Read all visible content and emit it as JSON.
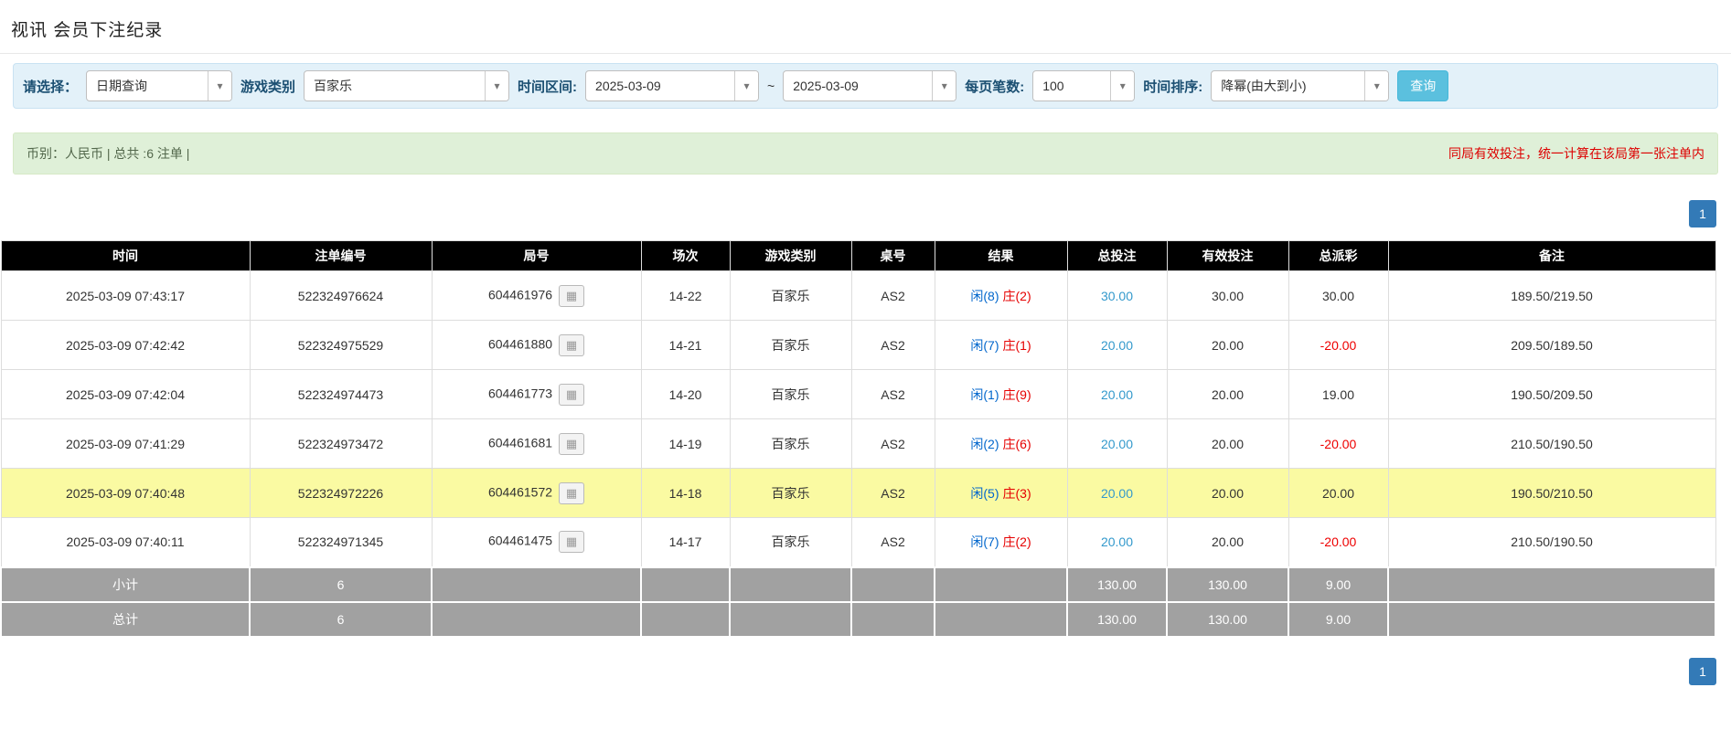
{
  "page": {
    "title": "视讯 会员下注纪录"
  },
  "filters": {
    "select_label": "请选择：",
    "select_value": "日期查询",
    "game_type_label": "游戏类别",
    "game_type_value": "百家乐",
    "date_range_label": "时间区间:",
    "date_from": "2025-03-09",
    "date_separator": "~",
    "date_to": "2025-03-09",
    "page_size_label": "每页笔数:",
    "page_size_value": "100",
    "sort_label": "时间排序:",
    "sort_value": "降幂(由大到小)",
    "search_button": "查询"
  },
  "summary": {
    "left": "币别：人民币 | 总共 :6 注单 |",
    "right": "同局有效投注，统一计算在该局第一张注单内"
  },
  "pagination": {
    "page": "1"
  },
  "icons": {
    "dropdown_caret": "▾",
    "road_icon": "▦"
  },
  "colors": {
    "accent_link_blue": "#3399cc",
    "player_blue": "#0066cc",
    "banker_red": "#e60000",
    "negative_red": "#ee0000",
    "highlight_yellow": "#fafaa2",
    "header_black": "#000000",
    "footer_gray": "#a1a1a1",
    "search_button_blue": "#5bc0de",
    "pagination_blue": "#337ab7",
    "filter_bar_blue": "#e3f1f9",
    "summary_bar_green": "#dff0d8",
    "note_red": "#dd0000"
  },
  "table": {
    "headers": [
      "时间",
      "注单编号",
      "局号",
      "场次",
      "游戏类别",
      "桌号",
      "结果",
      "总投注",
      "有效投注",
      "总派彩",
      "备注"
    ],
    "rows": [
      {
        "time": "2025-03-09 07:43:17",
        "bet_id": "522324976624",
        "round_no": "604461976",
        "session": "14-22",
        "game": "百家乐",
        "table_no": "AS2",
        "result_player": "闲(8)",
        "result_banker": "庄(2)",
        "total_bet": "30.00",
        "valid_bet": "30.00",
        "payout": "30.00",
        "note": "189.50/219.50",
        "highlighted": false
      },
      {
        "time": "2025-03-09 07:42:42",
        "bet_id": "522324975529",
        "round_no": "604461880",
        "session": "14-21",
        "game": "百家乐",
        "table_no": "AS2",
        "result_player": "闲(7)",
        "result_banker": "庄(1)",
        "total_bet": "20.00",
        "valid_bet": "20.00",
        "payout": "-20.00",
        "note": "209.50/189.50",
        "highlighted": false
      },
      {
        "time": "2025-03-09 07:42:04",
        "bet_id": "522324974473",
        "round_no": "604461773",
        "session": "14-20",
        "game": "百家乐",
        "table_no": "AS2",
        "result_player": "闲(1)",
        "result_banker": "庄(9)",
        "total_bet": "20.00",
        "valid_bet": "20.00",
        "payout": "19.00",
        "note": "190.50/209.50",
        "highlighted": false
      },
      {
        "time": "2025-03-09 07:41:29",
        "bet_id": "522324973472",
        "round_no": "604461681",
        "session": "14-19",
        "game": "百家乐",
        "table_no": "AS2",
        "result_player": "闲(2)",
        "result_banker": "庄(6)",
        "total_bet": "20.00",
        "valid_bet": "20.00",
        "payout": "-20.00",
        "note": "210.50/190.50",
        "highlighted": false
      },
      {
        "time": "2025-03-09 07:40:48",
        "bet_id": "522324972226",
        "round_no": "604461572",
        "session": "14-18",
        "game": "百家乐",
        "table_no": "AS2",
        "result_player": "闲(5)",
        "result_banker": "庄(3)",
        "total_bet": "20.00",
        "valid_bet": "20.00",
        "payout": "20.00",
        "note": "190.50/210.50",
        "highlighted": true
      },
      {
        "time": "2025-03-09 07:40:11",
        "bet_id": "522324971345",
        "round_no": "604461475",
        "session": "14-17",
        "game": "百家乐",
        "table_no": "AS2",
        "result_player": "闲(7)",
        "result_banker": "庄(2)",
        "total_bet": "20.00",
        "valid_bet": "20.00",
        "payout": "-20.00",
        "note": "210.50/190.50",
        "highlighted": false
      }
    ],
    "subtotal": {
      "label": "小计",
      "count": "6",
      "total_bet": "130.00",
      "valid_bet": "130.00",
      "payout": "9.00"
    },
    "total": {
      "label": "总计",
      "count": "6",
      "total_bet": "130.00",
      "valid_bet": "130.00",
      "payout": "9.00"
    }
  }
}
